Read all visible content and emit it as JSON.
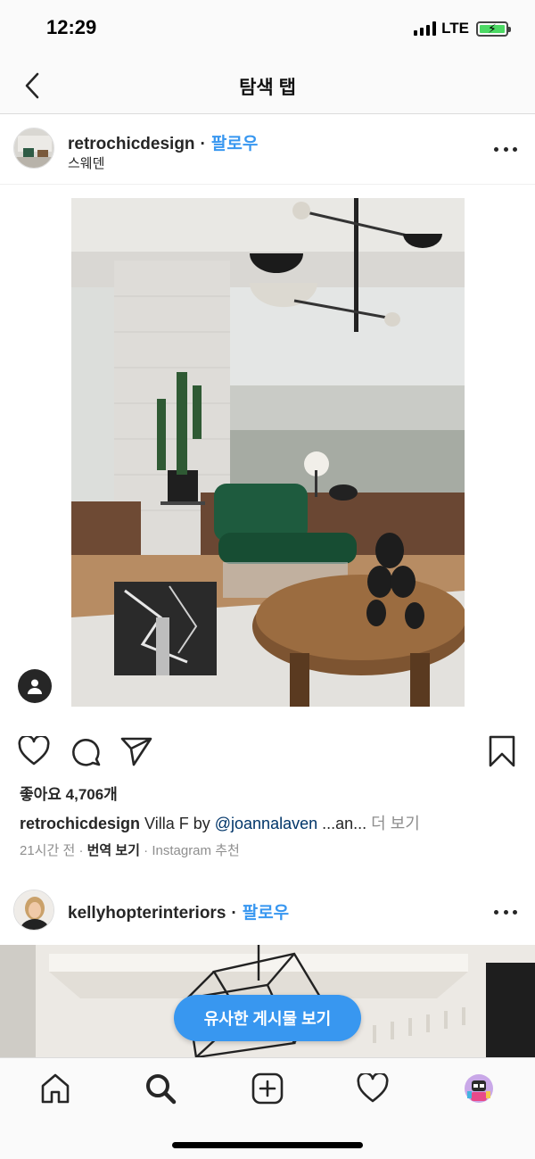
{
  "status_bar": {
    "time": "12:29",
    "network": "LTE"
  },
  "nav": {
    "title": "탐색 탭"
  },
  "post1": {
    "username": "retrochicdesign",
    "follow_label": "팔로우",
    "location": "스웨덴",
    "likes": "좋아요 4,706개",
    "caption": {
      "username": "retrochicdesign",
      "text": " Villa F by ",
      "mention": "@joannalaven",
      "ellipsis": " ...an...",
      "more": " 더 보기"
    },
    "meta": {
      "time": "21시간 전",
      "translate": "번역 보기",
      "recommended": "Instagram 추천"
    }
  },
  "post2": {
    "username": "kellyhopterinteriors",
    "follow_label": "팔로우"
  },
  "similar_button": {
    "label": "유사한 게시물 보기"
  },
  "colors": {
    "accent": "#3897f0",
    "text": "#262626",
    "muted": "#8e8e8e",
    "mention": "#003569"
  },
  "icons": {
    "back": "chevron-left-icon",
    "more": "more-horizontal-icon",
    "like": "heart-icon",
    "comment": "comment-icon",
    "share": "paper-plane-icon",
    "save": "bookmark-icon",
    "tag": "user-tag-icon",
    "tabs": [
      "home-icon",
      "search-icon",
      "add-post-icon",
      "activity-heart-icon",
      "profile-avatar"
    ]
  }
}
